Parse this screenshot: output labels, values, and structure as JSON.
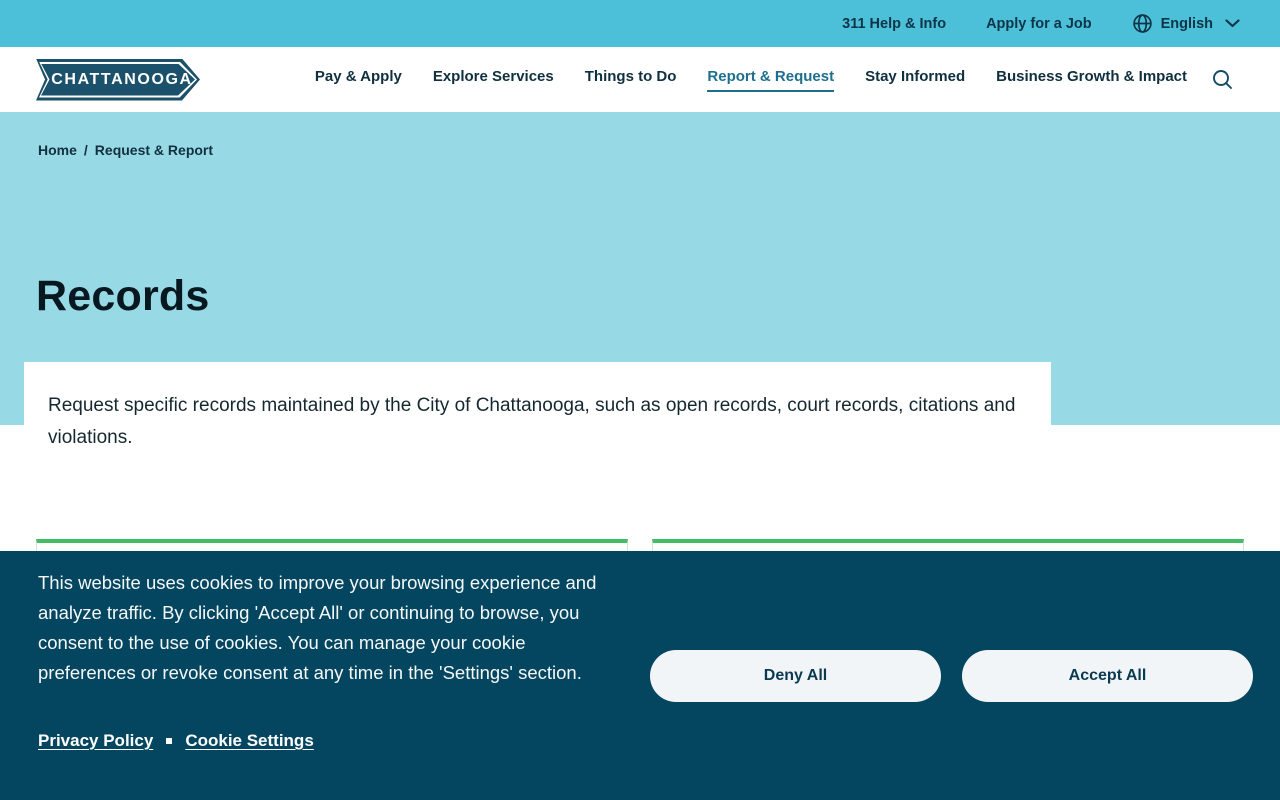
{
  "topbar": {
    "links": [
      {
        "label": "311 Help & Info"
      },
      {
        "label": "Apply for a Job"
      }
    ],
    "language": {
      "label": "English"
    }
  },
  "header": {
    "logo_text": "CHATTANOOGA",
    "nav": [
      {
        "label": "Pay & Apply"
      },
      {
        "label": "Explore Services"
      },
      {
        "label": "Things to Do"
      },
      {
        "label": "Report & Request",
        "active": true
      },
      {
        "label": "Stay Informed"
      },
      {
        "label": "Business Growth & Impact"
      }
    ]
  },
  "breadcrumb": {
    "home": "Home",
    "separator": "/",
    "current": "Request & Report"
  },
  "hero": {
    "title": "Records"
  },
  "main": {
    "intro": "Request specific records maintained by the City of Chattanooga, such as open records, court records, citations and violations."
  },
  "cookie_banner": {
    "message": "This website uses cookies to improve your browsing experience and analyze traffic. By clicking 'Accept All' or continuing to browse, you consent to the use of cookies. You can manage your cookie preferences or revoke consent at any time in the 'Settings' section.",
    "privacy_policy_label": "Privacy Policy",
    "cookie_settings_label": "Cookie Settings",
    "deny_label": "Deny All",
    "accept_label": "Accept All"
  },
  "colors": {
    "topbar_teal": "#4CC0D9",
    "hero_blue": "#98D9E6",
    "banner_navy": "#04465F",
    "logo_navy": "#1B516B",
    "card_green": "#3FBE63",
    "active_link": "#1D6F8D"
  }
}
